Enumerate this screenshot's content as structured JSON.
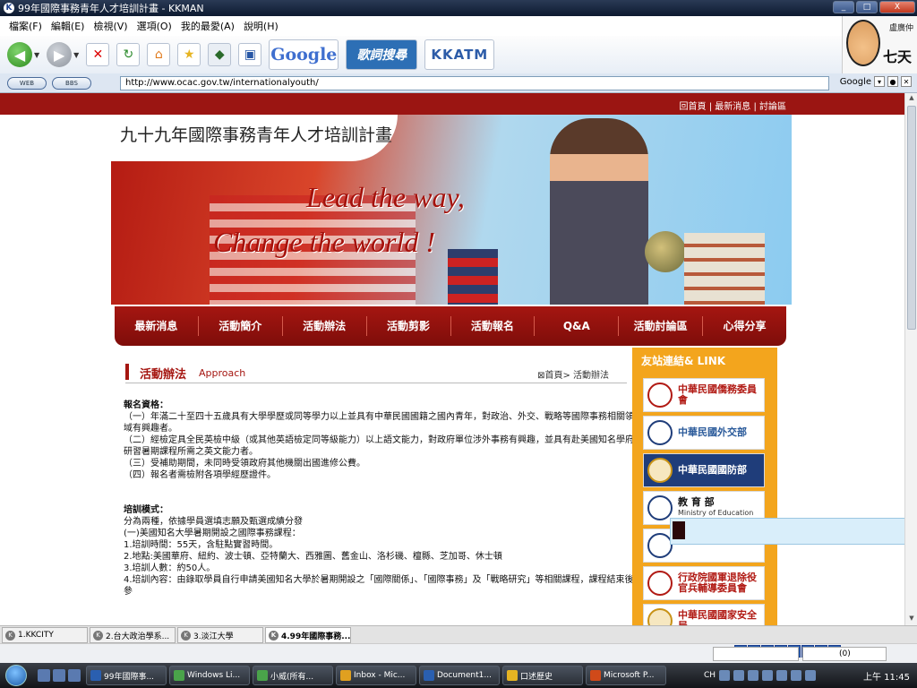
{
  "window": {
    "title": "99年國際事務青年人才培訓計畫 - KKMAN",
    "controls": [
      "_",
      "□",
      "X"
    ]
  },
  "menu": [
    "檔案(F)",
    "編輯(E)",
    "檢視(V)",
    "選項(O)",
    "我的最愛(A)",
    "說明(H)"
  ],
  "toolbar": {
    "google": "Google",
    "lyric": "歌詞搜尋",
    "kkatm": "KKATM"
  },
  "profile": {
    "username": "盧廣仲",
    "days": "七天"
  },
  "address": {
    "web_pill": "WEB",
    "bbs_pill": "BBS",
    "url": "http://www.ocac.gov.tw/internationalyouth/",
    "search_label": "Google"
  },
  "site": {
    "top_links": "回首頁 | 最新消息 | 討論區",
    "title": "九十九年國際事務青年人才培訓計畫",
    "slogan1": "Lead the way,",
    "slogan2": "Change the world !",
    "nav": [
      "最新消息",
      "活動簡介",
      "活動辦法",
      "活動剪影",
      "活動報名",
      "Q&A",
      "活動討論區",
      "心得分享"
    ],
    "section_title": "活動辦法",
    "section_title_en": "Approach",
    "breadcrumb": "⊠首頁> 活動辦法",
    "content": [
      "報名資格：",
      "（一）年滿二十至四十五歲具有大學學歷或同等學力以上並具有中華民國國籍之國內青年，對政治、外交、戰略等國際事務相關領域有興趣者。",
      "（二）經檢定具全民英檢中級（或其他英語檢定同等級能力）以上語文能力，對政府單位涉外事務有興趣，並具有赴美國知名學府研習暑期課程所需之英文能力者。",
      "（三）受補助期間，未同時受領政府其他機關出國進修公費。",
      "（四）報名者需檢附各項學經歷證件。",
      "培訓模式：",
      "分為兩種，依據學員選填志願及甄選成績分發",
      "(一)美國知名大學暑期開設之國際事務課程：",
      "1.培訓時間：55天，含駐點實習時間。",
      "2.地點:美國華府、紐約、波士頓、亞特蘭大、西雅圖、舊金山、洛杉磯、檀縣、芝加哥、休士頓",
      "3.培訓人數：約50人。",
      "4.培訓內容：由錄取學員自行申請美國知名大學於暑期開設之「國際關係」、「國際事務」及「戰略研究」等相關課程，課程結束後參"
    ],
    "sidebar": {
      "title": "友站連結& LINK",
      "links": [
        {
          "name": "中華民國僑務委員會"
        },
        {
          "name": "中華民國外交部"
        },
        {
          "name": "中華民國國防部"
        },
        {
          "name": "教 育 部",
          "sub": "Ministry of Education"
        },
        {
          "name": ""
        },
        {
          "name": "行政院國軍退除役官兵輔導委員會"
        },
        {
          "name": "中華民國國家安全局"
        }
      ]
    }
  },
  "tabs": [
    "1.KKCITY",
    "2.台大政治學系...",
    "3.淡江大學",
    "4.99年國際事務..."
  ],
  "status": {
    "zoom": "(0)"
  },
  "taskbar": {
    "items": [
      "99年國際事...",
      "Windows Li...",
      "小威(所有...",
      "Inbox - Mic...",
      "Document1...",
      "口述歷史",
      "Microsoft P..."
    ],
    "lang": "CH",
    "clock": "上午 11:45"
  }
}
